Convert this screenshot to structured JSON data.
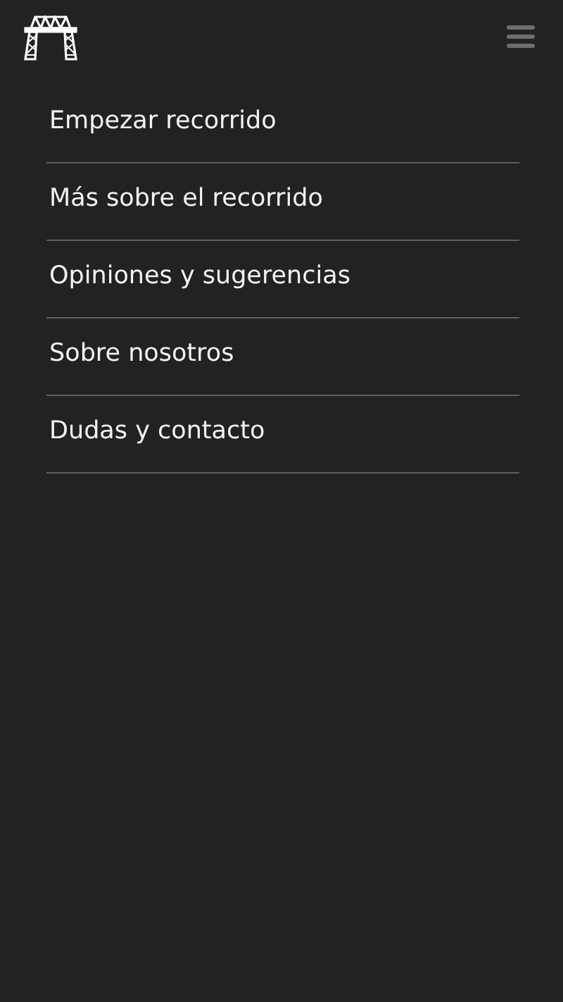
{
  "menu": [
    {
      "label": "Empezar recorrido"
    },
    {
      "label": "Más sobre el recorrido"
    },
    {
      "label": "Opiniones y sugerencias"
    },
    {
      "label": "Sobre nosotros"
    },
    {
      "label": "Dudas y contacto"
    }
  ]
}
